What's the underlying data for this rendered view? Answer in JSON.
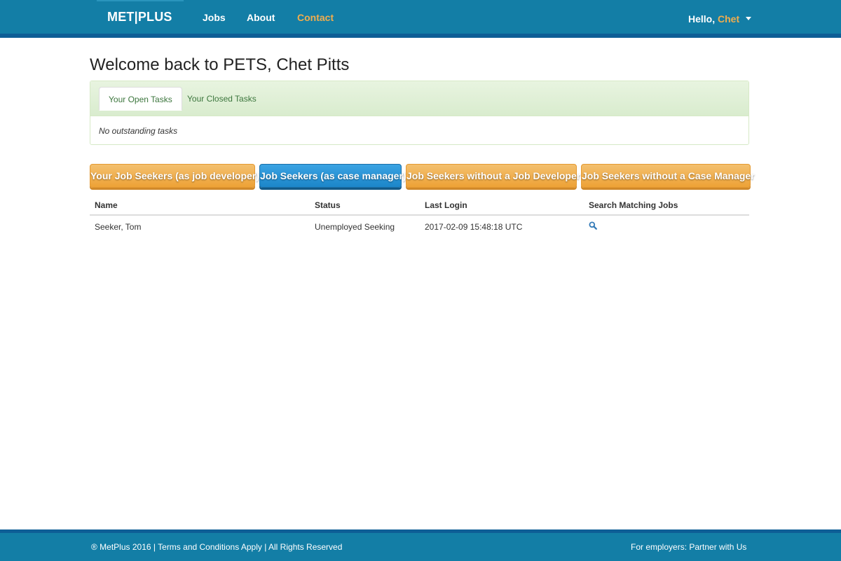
{
  "navbar": {
    "brand": "MET|PLUS",
    "links": [
      "Jobs",
      "About",
      "Contact"
    ],
    "greeting": "Hello,",
    "user": "Chet",
    "accent_color": "#f0ad4e",
    "bg_color": "#137ea6"
  },
  "page": {
    "title": "Welcome back to PETS, Chet Pitts"
  },
  "tasks": {
    "tabs": [
      "Your Open Tasks",
      "Your Closed Tasks"
    ],
    "empty_message": "No outstanding tasks"
  },
  "buttons": [
    "Your Job Seekers (as job developer)",
    "Job Seekers (as case manager)",
    "Job Seekers without a  Job Developer",
    "Job Seekers without a Case Manager"
  ],
  "table": {
    "headers": [
      "Name",
      "Status",
      "Last Login",
      "Search Matching Jobs"
    ],
    "rows": [
      {
        "name": "Seeker, Tom",
        "status": "Unemployed Seeking",
        "last_login": "2017-02-09 15:48:18 UTC",
        "icon": "search-icon"
      }
    ]
  },
  "footer": {
    "copyright": "® MetPlus 2016",
    "separator1": " | ",
    "terms": "Terms and Conditions Apply",
    "separator2": " | All Rights Reserved",
    "employers_prefix": "For employers: ",
    "employers_link": "Partner with Us"
  }
}
